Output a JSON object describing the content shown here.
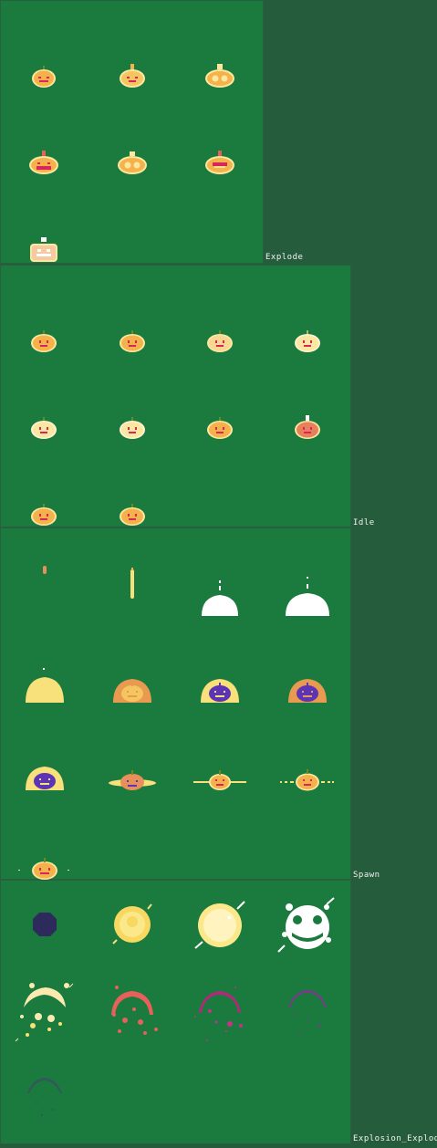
{
  "colors": {
    "background": "#255c3c",
    "sheet": "#1b7a3d",
    "pumpkin": "#f5b24a",
    "pumpkin_light": "#f8e08a",
    "face": "#d9245e",
    "purple": "#5b35b5",
    "navy": "#2d2b5c",
    "white": "#ffffff",
    "coral": "#e8605a"
  },
  "sheets": [
    {
      "label": "Explode",
      "frames": 7
    },
    {
      "label": "Idle",
      "frames": 10
    },
    {
      "label": "Spawn",
      "frames": 13
    },
    {
      "label": "Explosion_Explode",
      "frames": 9
    }
  ]
}
